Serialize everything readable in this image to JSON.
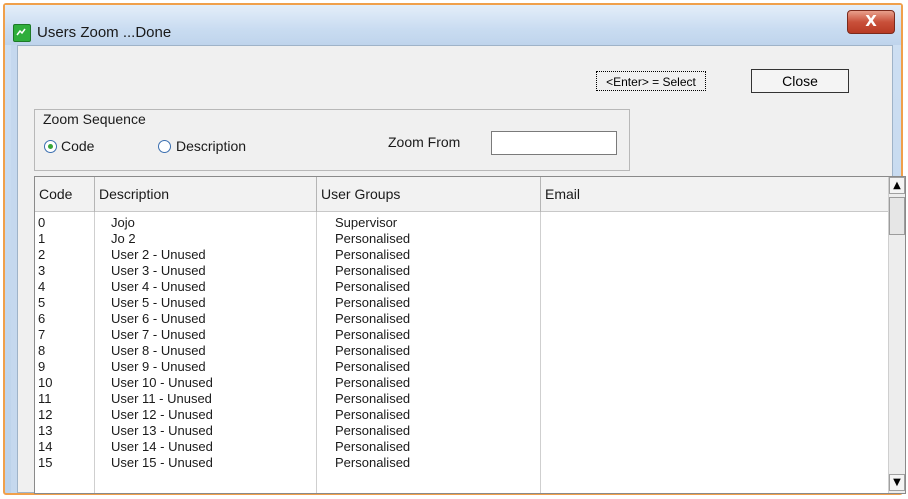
{
  "window": {
    "title": "Users Zoom ...Done",
    "close_glyph": "X"
  },
  "toolbar": {
    "select_label": "<Enter> = Select",
    "close_label": "Close"
  },
  "zoom_sequence": {
    "legend": "Zoom Sequence",
    "options": [
      {
        "label": "Code",
        "selected": true
      },
      {
        "label": "Description",
        "selected": false
      }
    ],
    "zoom_from_label": "Zoom From",
    "zoom_from_value": "",
    "zoom_from_placeholder": ""
  },
  "grid": {
    "columns": [
      "Code",
      "Description",
      "User Groups",
      "Email"
    ],
    "rows": [
      {
        "code": "0",
        "description": "Jojo",
        "group": "Supervisor",
        "email": ""
      },
      {
        "code": "1",
        "description": "Jo 2",
        "group": "Personalised",
        "email": ""
      },
      {
        "code": "2",
        "description": "User 2  - Unused",
        "group": "Personalised",
        "email": ""
      },
      {
        "code": "3",
        "description": "User 3  - Unused",
        "group": "Personalised",
        "email": ""
      },
      {
        "code": "4",
        "description": "User 4  - Unused",
        "group": "Personalised",
        "email": ""
      },
      {
        "code": "5",
        "description": "User 5  - Unused",
        "group": "Personalised",
        "email": ""
      },
      {
        "code": "6",
        "description": "User 6  - Unused",
        "group": "Personalised",
        "email": ""
      },
      {
        "code": "7",
        "description": "User 7  - Unused",
        "group": "Personalised",
        "email": ""
      },
      {
        "code": "8",
        "description": "User 8  - Unused",
        "group": "Personalised",
        "email": ""
      },
      {
        "code": "9",
        "description": "User 9  - Unused",
        "group": "Personalised",
        "email": ""
      },
      {
        "code": "10",
        "description": "User 10  - Unused",
        "group": "Personalised",
        "email": ""
      },
      {
        "code": "11",
        "description": "User 11  - Unused",
        "group": "Personalised",
        "email": ""
      },
      {
        "code": "12",
        "description": "User 12  - Unused",
        "group": "Personalised",
        "email": ""
      },
      {
        "code": "13",
        "description": "User 13  - Unused",
        "group": "Personalised",
        "email": ""
      },
      {
        "code": "14",
        "description": "User 14  - Unused",
        "group": "Personalised",
        "email": ""
      },
      {
        "code": "15",
        "description": "User 15  - Unused",
        "group": "Personalised",
        "email": ""
      }
    ]
  },
  "scrollbar": {
    "up_glyph": "▲",
    "down_glyph": "▼"
  },
  "colors": {
    "window_border": "#f0a04b",
    "radio_selected": "#37a537",
    "close_button": "#c9503a"
  }
}
